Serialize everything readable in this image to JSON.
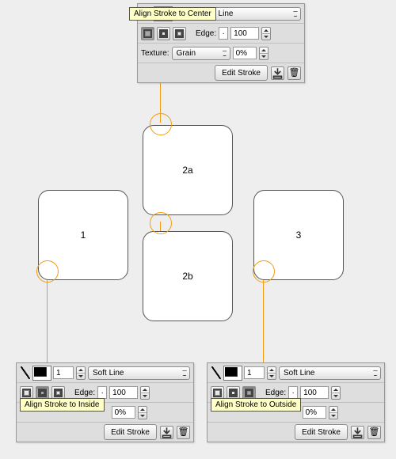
{
  "tooltips": {
    "center": "Align Stroke to Center",
    "inside": "Align Stroke to Inside",
    "outside": "Align Stroke to Outside"
  },
  "labels": {
    "edge": "Edge:",
    "texture": "Texture:",
    "editStroke": "Edit Stroke",
    "softLine": "Soft Line",
    "line_t": "t Line",
    "grain": "Grain"
  },
  "values": {
    "strokeWidth": "1",
    "edge": "100",
    "texturePct": "0%"
  },
  "shapes": {
    "s1": "1",
    "s2a": "2a",
    "s2b": "2b",
    "s3": "3"
  }
}
